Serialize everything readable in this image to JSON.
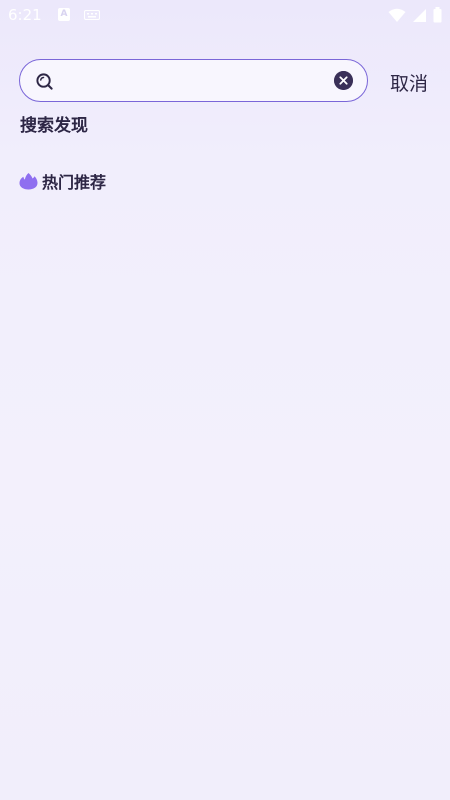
{
  "status_bar": {
    "time": "6:21",
    "app_icon_letter": "A"
  },
  "search": {
    "value": "",
    "placeholder": "",
    "cancel_label": "取消"
  },
  "discover": {
    "title": "搜索发现"
  },
  "hot": {
    "label": "热门推荐",
    "icon": "flame-icon"
  },
  "colors": {
    "accent": "#7a66d8",
    "text": "#2d2645",
    "flame": "#8f6ff0"
  }
}
